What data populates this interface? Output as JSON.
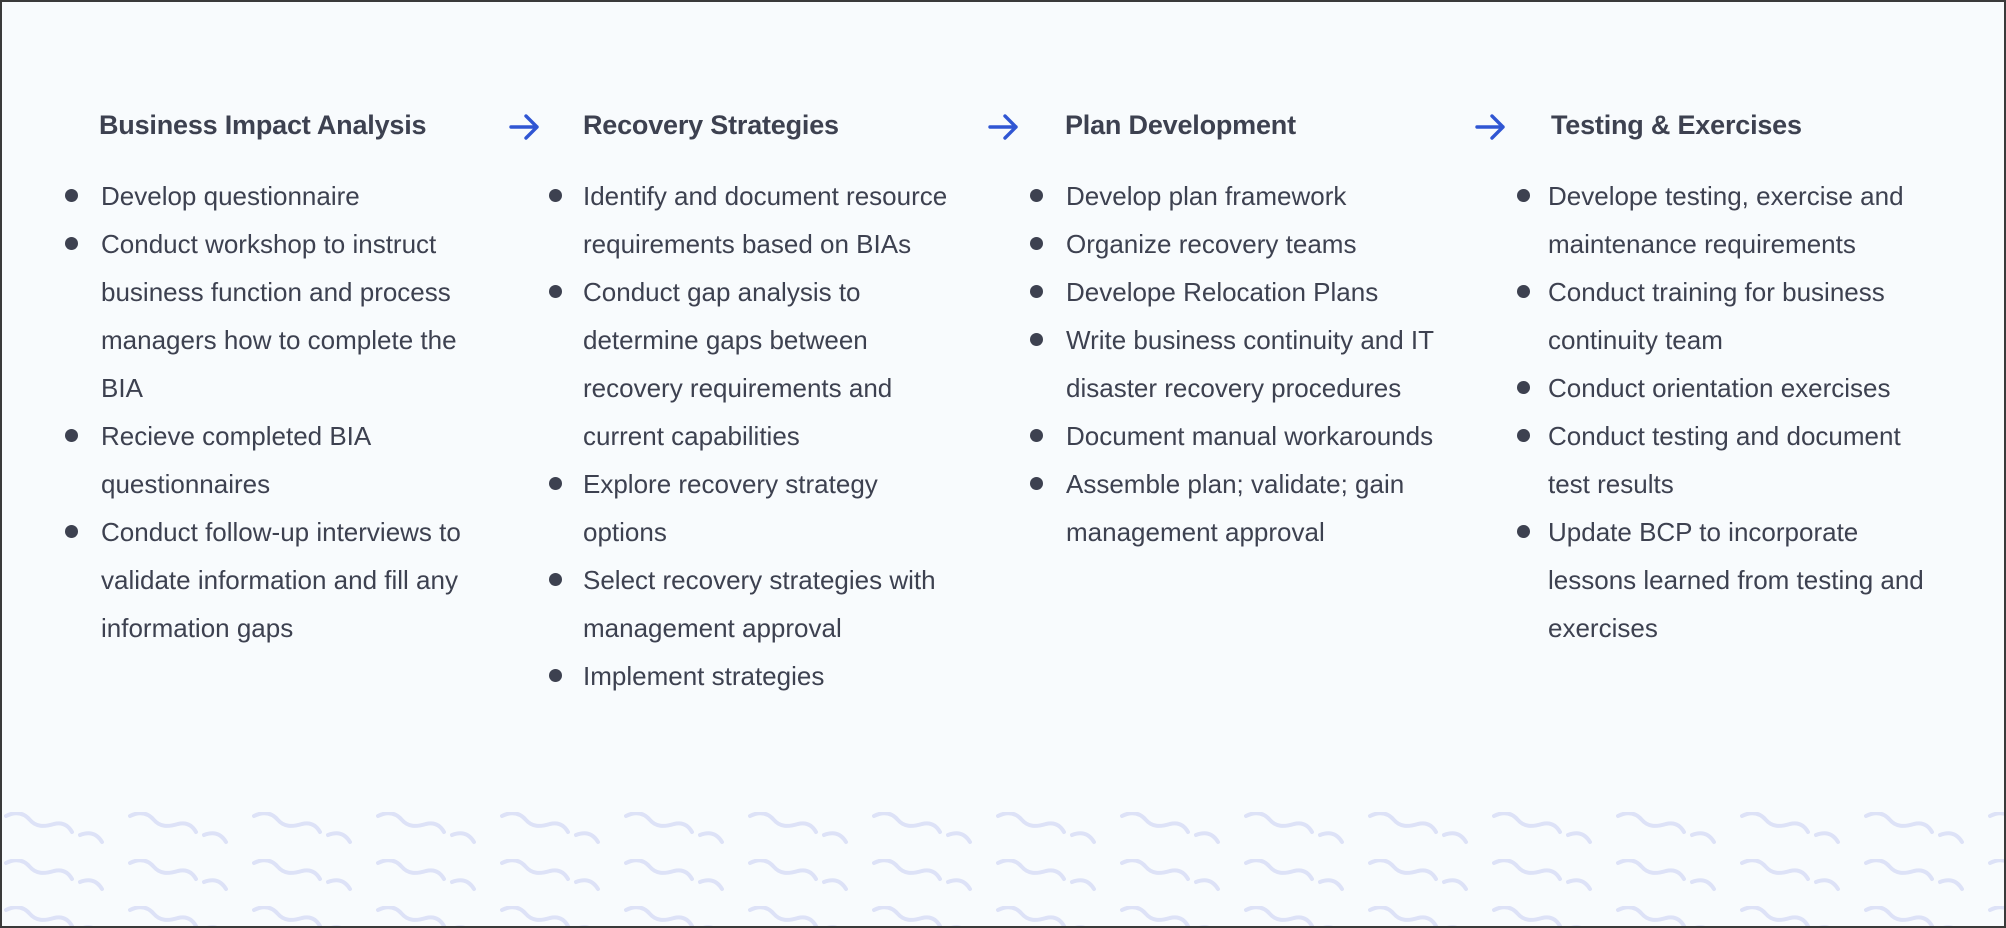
{
  "colors": {
    "arrow": "#3056d3",
    "text": "#3d4150",
    "wave": "#dde2f7",
    "background": "#f8fbfd"
  },
  "columns": [
    {
      "title": "Business Impact Analysis",
      "items": [
        "Develop questionnaire",
        "Conduct workshop to instruct business function and process managers how to complete the BIA",
        "Recieve completed BIA questionnaires",
        "Conduct follow-up interviews to validate information and fill any information gaps"
      ]
    },
    {
      "title": "Recovery Strategies",
      "arrow_icon": "arrow-right",
      "items": [
        "Identify and document resource requirements based on BIAs",
        "Conduct gap analysis to determine gaps between recovery requirements and current capabilities",
        "Explore recovery strategy options",
        "Select recovery strategies with management approval",
        "Implement strategies"
      ]
    },
    {
      "title": "Plan Development",
      "arrow_icon": "arrow-right",
      "items": [
        "Develop plan framework",
        "Organize recovery teams",
        "Develope Relocation Plans",
        "Write business continuity and IT disaster recovery procedures",
        "Document manual workarounds",
        "Assemble plan; validate; gain management approval"
      ]
    },
    {
      "title": "Testing & Exercises",
      "arrow_icon": "arrow-right",
      "items": [
        "Develope testing, exercise and maintenance requirements",
        "Conduct training for business continuity team",
        "Conduct orientation exercises",
        "Conduct testing and document test results",
        "Update BCP to incorporate lessons learned from testing and exercises"
      ]
    }
  ]
}
